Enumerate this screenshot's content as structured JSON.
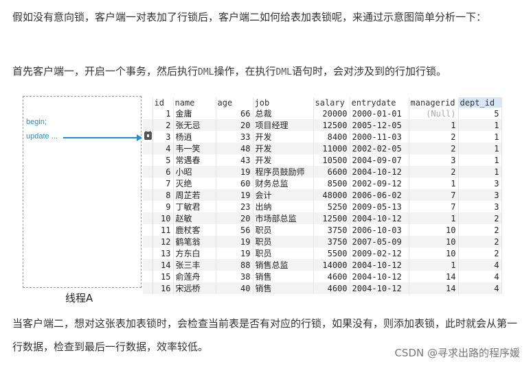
{
  "paragraphs": {
    "p1": "假如没有意向锁，客户端一对表加了行锁后，客户端二如何给表加表锁呢，来通过示意图简单分析一下：",
    "p2_a": "首先客户端一，开启一个事务，然后执行",
    "p2_dml1": "DML",
    "p2_b": "操作，在执行",
    "p2_dml2": "DML",
    "p2_c": "语句时，会对涉及到的行加行锁。",
    "p3": "当客户端二，想对这张表加表锁时，会检查当前表是否有对应的行锁，如果没有，则添加表锁，此时就会从第一行数据，检查到最后一行数据，效率较低。"
  },
  "thread": {
    "begin": "begin;",
    "update": "update ...",
    "caption": "线程A"
  },
  "table": {
    "columns": [
      "id",
      "name",
      "age",
      "job",
      "salary",
      "entrydate",
      "managerid",
      "dept_id"
    ],
    "active_column": "dept_id",
    "locked_row_index": 2,
    "rows": [
      [
        "1",
        "金庸",
        "66",
        "总裁",
        "20000",
        "2000-01-01",
        "(Null)",
        "5"
      ],
      [
        "2",
        "张无忌",
        "20",
        "项目经理",
        "12500",
        "2005-12-05",
        "1",
        "1"
      ],
      [
        "3",
        "杨逍",
        "33",
        "开发",
        "8400",
        "2000-11-03",
        "2",
        "1"
      ],
      [
        "4",
        "韦一笑",
        "48",
        "开发",
        "11000",
        "2002-02-05",
        "2",
        "1"
      ],
      [
        "5",
        "常遇春",
        "43",
        "开发",
        "10500",
        "2004-09-07",
        "3",
        "1"
      ],
      [
        "6",
        "小昭",
        "19",
        "程序员鼓励师",
        "6600",
        "2004-10-12",
        "2",
        "1"
      ],
      [
        "7",
        "灭绝",
        "60",
        "财务总监",
        "8500",
        "2002-09-12",
        "1",
        "3"
      ],
      [
        "8",
        "周芷若",
        "19",
        "会计",
        "48000",
        "2006-06-02",
        "7",
        "3"
      ],
      [
        "9",
        "丁敏君",
        "23",
        "出纳",
        "5250",
        "2009-05-13",
        "7",
        "3"
      ],
      [
        "10",
        "赵敏",
        "20",
        "市场部总监",
        "12500",
        "2004-10-12",
        "1",
        "2"
      ],
      [
        "11",
        "鹿杖客",
        "56",
        "职员",
        "3750",
        "2006-10-03",
        "10",
        "2"
      ],
      [
        "12",
        "鹤笔翁",
        "19",
        "职员",
        "3750",
        "2007-05-09",
        "10",
        "2"
      ],
      [
        "13",
        "方东白",
        "19",
        "职员",
        "5500",
        "2009-02-12",
        "10",
        "2"
      ],
      [
        "14",
        "张三丰",
        "88",
        "销售总监",
        "14000",
        "2004-10-12",
        "1",
        "4"
      ],
      [
        "15",
        "俞莲舟",
        "38",
        "销售",
        "4600",
        "2004-10-12",
        "14",
        "4"
      ],
      [
        "16",
        "宋远桥",
        "40",
        "销售",
        "4600",
        "2004-10-12",
        "14",
        "4"
      ]
    ]
  },
  "watermark": "CSDN @寻求出路的程序媛"
}
